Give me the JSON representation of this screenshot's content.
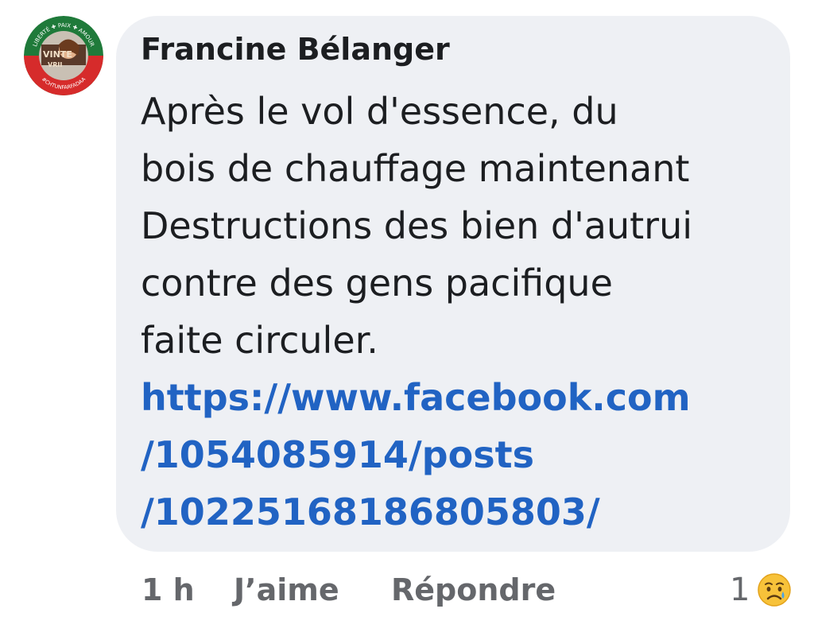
{
  "comment": {
    "author": "Francine Bélanger",
    "avatar_badge": {
      "ring_top_text": "LIBERTÉ ✚ PAIX ✚ AMOUR",
      "ring_bottom_text": "#CHTUNFARFADAA",
      "center_text_1": "VINTE",
      "center_text_2": "VRII"
    },
    "body_lines": [
      "Après le vol d'essence, du",
      "bois de chauffage maintenant",
      "Destructions des bien d'autrui",
      "contre des gens pacifique",
      "faite circuler."
    ],
    "link_lines": [
      "https://www.facebook.com",
      "/1054085914/posts",
      "/10225168186805803/"
    ],
    "timestamp": "1 h",
    "like_label": "J’aime",
    "reply_label": "Répondre",
    "reaction_count": "1",
    "reaction_icon": "sad-face-emoji"
  },
  "colors": {
    "bubble_bg": "#eef0f4",
    "text": "#1c1e21",
    "link": "#2163c3",
    "meta": "#65676b"
  }
}
